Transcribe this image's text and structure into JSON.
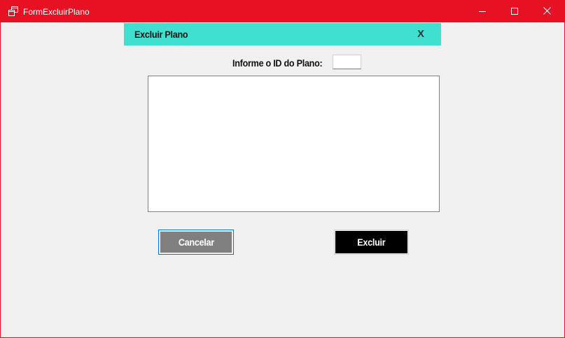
{
  "window": {
    "title": "FormExcluirPlano",
    "accent_color": "#e81123",
    "controls": {
      "minimize_icon": "minimize-icon",
      "maximize_icon": "maximize-icon",
      "close_icon": "close-icon"
    }
  },
  "header": {
    "title": "Excluir Plano",
    "close_label": "X",
    "background_color": "#40e0d0"
  },
  "form": {
    "id_label": "Informe o ID do Plano:",
    "id_value": "",
    "details_text": ""
  },
  "buttons": {
    "cancel_label": "Cancelar",
    "cancel_color": "#808080",
    "delete_label": "Excluir",
    "delete_color": "#000000"
  }
}
